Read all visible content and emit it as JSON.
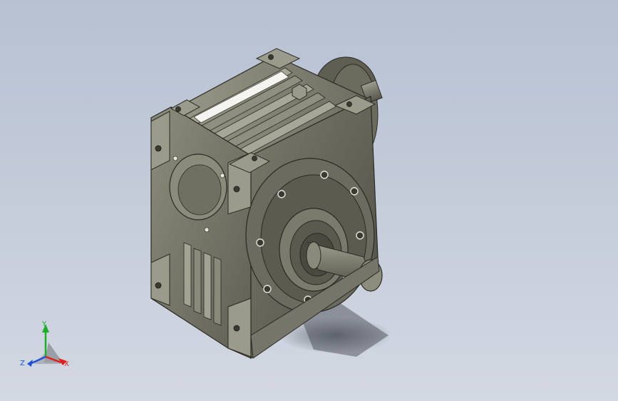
{
  "viewport": {
    "background_top": "#b7c1d2",
    "background_bottom": "#d3d8e2",
    "model": "worm-gear-reducer-icon"
  },
  "triad": {
    "y_label": "Y",
    "z_label": "Z",
    "x_label": "X",
    "colors": {
      "x": "#e02020",
      "y": "#1fae2b",
      "z": "#2050d8"
    }
  }
}
